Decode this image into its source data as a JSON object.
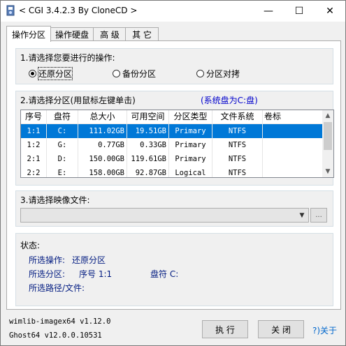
{
  "window": {
    "title": "< CGI 3.4.2.3 By CloneCD >",
    "controls": {
      "minimize": "—",
      "maximize": "☐",
      "close": "✕"
    }
  },
  "tabs": [
    {
      "label": "操作分区",
      "active": true
    },
    {
      "label": "操作硬盘",
      "active": false
    },
    {
      "label": "高 级",
      "active": false
    },
    {
      "label": "其 它",
      "active": false
    }
  ],
  "operation": {
    "label": "1.请选择您要进行的操作:",
    "options": [
      {
        "label": "还原分区",
        "selected": true
      },
      {
        "label": "备份分区",
        "selected": false
      },
      {
        "label": "分区对拷",
        "selected": false
      }
    ]
  },
  "partition": {
    "label": "2.请选择分区(用鼠标左键单击)",
    "system_disk": "(系统盘为C:盘)",
    "columns": [
      "序号",
      "盘符",
      "总大小",
      "可用空间",
      "分区类型",
      "文件系统",
      "卷标"
    ],
    "rows": [
      {
        "index": "1:1",
        "drive": "C:",
        "total": "111.02GB",
        "free": "19.51GB",
        "type": "Primary",
        "fs": "NTFS",
        "label": "",
        "selected": true
      },
      {
        "index": "1:2",
        "drive": "G:",
        "total": "0.77GB",
        "free": "0.33GB",
        "type": "Primary",
        "fs": "NTFS",
        "label": "",
        "selected": false
      },
      {
        "index": "2:1",
        "drive": "D:",
        "total": "150.00GB",
        "free": "119.61GB",
        "type": "Primary",
        "fs": "NTFS",
        "label": "",
        "selected": false
      },
      {
        "index": "2:2",
        "drive": "E:",
        "total": "158.00GB",
        "free": "92.87GB",
        "type": "Logical",
        "fs": "NTFS",
        "label": "",
        "selected": false
      }
    ]
  },
  "image": {
    "label": "3.请选择映像文件:",
    "value": "",
    "browse_label": "..."
  },
  "status": {
    "heading": "状态:",
    "op_label": "所选操作:",
    "op_value": "还原分区",
    "part_label": "所选分区:",
    "part_index": "序号 1:1",
    "part_drive": "盘符 C:",
    "path_label": "所选路径/文件:"
  },
  "footer": {
    "version1": "wimlib-imagex64 v1.12.0",
    "version2": "Ghost64 v12.0.0.10531",
    "execute_label": "执 行",
    "close_label": "关 闭",
    "about_label": "?)关于"
  },
  "colors": {
    "selection": "#0078d7",
    "status_text": "#001a80",
    "system_disk": "#0000cc",
    "link": "#0066cc"
  }
}
